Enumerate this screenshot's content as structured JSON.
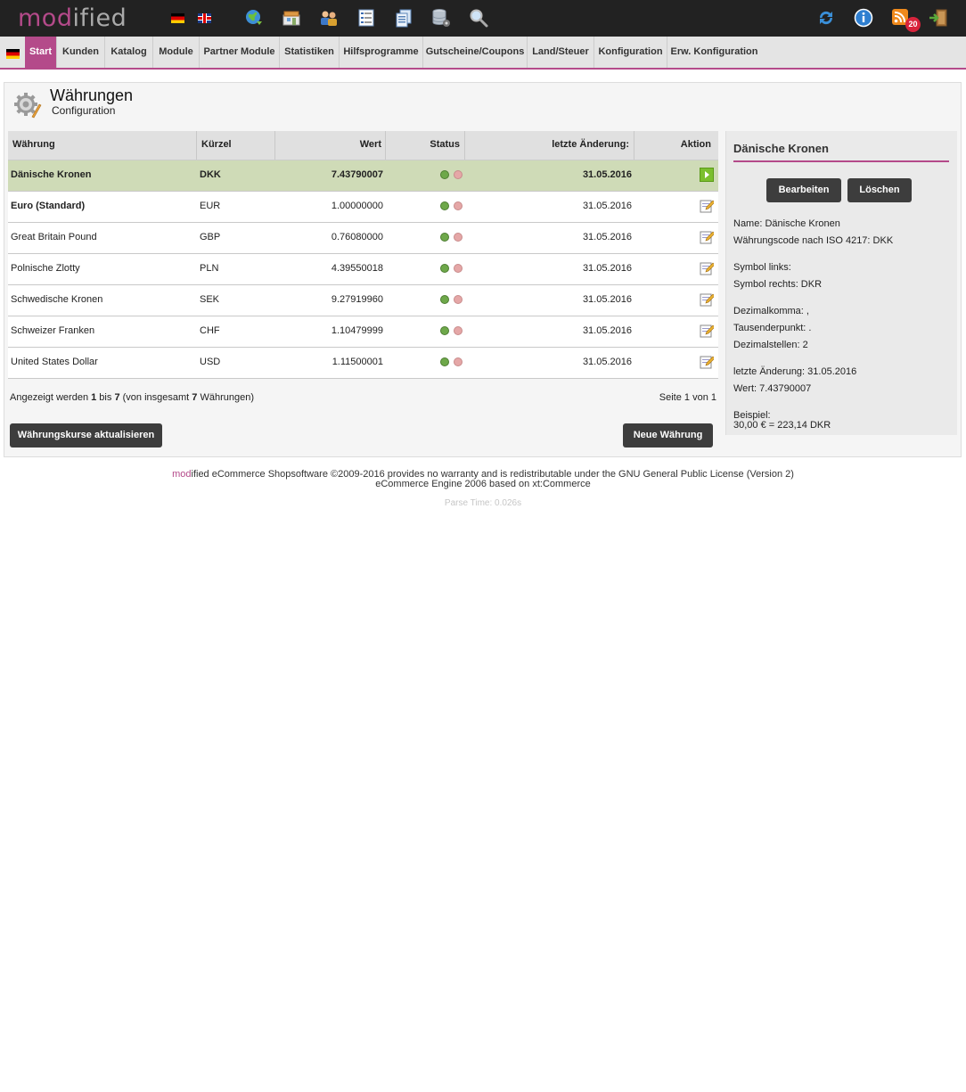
{
  "header": {
    "logo_prefix": "mod",
    "logo_suffix": "ified",
    "notification_count": "20",
    "icons": [
      "flag-de-icon",
      "flag-uk-icon",
      "globe-icon",
      "shop-icon",
      "customers-icon",
      "orders-list-icon",
      "documents-icon",
      "database-icon",
      "search-icon",
      "refresh-icon",
      "info-icon",
      "rss-icon",
      "logout-icon"
    ]
  },
  "nav": {
    "items": [
      "Start",
      "Kunden",
      "Katalog",
      "Module",
      "Partner Module",
      "Statistiken",
      "Hilfsprogramme",
      "Gutscheine/Coupons",
      "Land/Steuer",
      "Konfiguration",
      "Erw. Konfiguration"
    ],
    "active": "Start"
  },
  "page": {
    "title": "Währungen",
    "subtitle": "Configuration"
  },
  "table": {
    "headers": {
      "currency": "Währung",
      "code": "Kürzel",
      "value": "Wert",
      "status": "Status",
      "last_change": "letzte Änderung:",
      "action": "Aktion"
    },
    "rows": [
      {
        "currency": "Dänische Kronen",
        "code": "DKK",
        "value": "7.43790007",
        "status": "active",
        "last_change": "31.05.2016"
      },
      {
        "currency": "Euro (Standard)",
        "code": "EUR",
        "value": "1.00000000",
        "status": "active",
        "last_change": "31.05.2016"
      },
      {
        "currency": "Great Britain Pound",
        "code": "GBP",
        "value": "0.76080000",
        "status": "active",
        "last_change": "31.05.2016"
      },
      {
        "currency": "Polnische Zlotty",
        "code": "PLN",
        "value": "4.39550018",
        "status": "active",
        "last_change": "31.05.2016"
      },
      {
        "currency": "Schwedische Kronen",
        "code": "SEK",
        "value": "9.27919960",
        "status": "active",
        "last_change": "31.05.2016"
      },
      {
        "currency": "Schweizer Franken",
        "code": "CHF",
        "value": "1.10479999",
        "status": "active",
        "last_change": "31.05.2016"
      },
      {
        "currency": "United States Dollar",
        "code": "USD",
        "value": "1.11500001",
        "status": "active",
        "last_change": "31.05.2016"
      }
    ],
    "paging": {
      "prefix": "Angezeigt werden ",
      "from": "1",
      "mid": " bis ",
      "to": "7",
      "mid2": " (von insgesamt ",
      "total": "7",
      "suffix": " Währungen)",
      "page_info": "Seite 1 von 1"
    },
    "update_button": "Währungskurse aktualisieren",
    "new_button": "Neue Währung"
  },
  "details": {
    "title": "Dänische Kronen",
    "edit_button": "Bearbeiten",
    "delete_button": "Löschen",
    "name": "Name: Dänische Kronen",
    "iso_code": "Währungscode nach ISO 4217: DKK",
    "symbol_left": "Symbol links:",
    "symbol_right": "Symbol rechts: DKR",
    "decimal_point": "Dezimalkomma: ,",
    "thousands_point": "Tausenderpunkt: .",
    "decimal_places": "Dezimalstellen: 2",
    "last_change": "letzte Änderung: 31.05.2016",
    "value": "Wert: 7.43790007",
    "example_label": "Beispiel:",
    "example_value": "30,00 € = 223,14 DKR"
  },
  "footer": {
    "brand_prefix": "mod",
    "line1_rest": "ified eCommerce Shopsoftware ©2009-2016 provides no warranty and is redistributable under the GNU General Public License (Version 2)",
    "line2": "eCommerce Engine 2006 based on xt:Commerce",
    "parse_time": "Parse Time: 0.026s"
  },
  "colors": {
    "accent": "#b44a8a",
    "topbar": "#222222",
    "selected_row": "#cfdbb7",
    "status_on": "#6ea84a",
    "status_off": "#e5a7a7",
    "button": "#3d3d3d"
  }
}
